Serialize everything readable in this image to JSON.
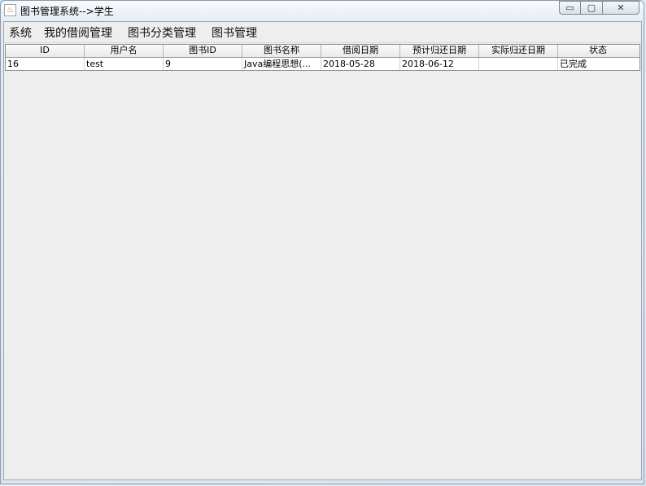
{
  "window": {
    "title": "图书管理系统-->学生",
    "min_label": "▭",
    "max_label": "▢",
    "close_label": "✕"
  },
  "menu": {
    "items": [
      "系统",
      "我的借阅管理",
      "图书分类管理",
      "图书管理"
    ]
  },
  "table": {
    "columns": [
      "ID",
      "用户名",
      "图书ID",
      "图书名称",
      "借阅日期",
      "预计归还日期",
      "实际归还日期",
      "状态"
    ],
    "rows": [
      [
        "16",
        "test",
        "9",
        "Java编程思想(...",
        "2018-05-28",
        "2018-06-12",
        "",
        "已完成"
      ]
    ]
  }
}
